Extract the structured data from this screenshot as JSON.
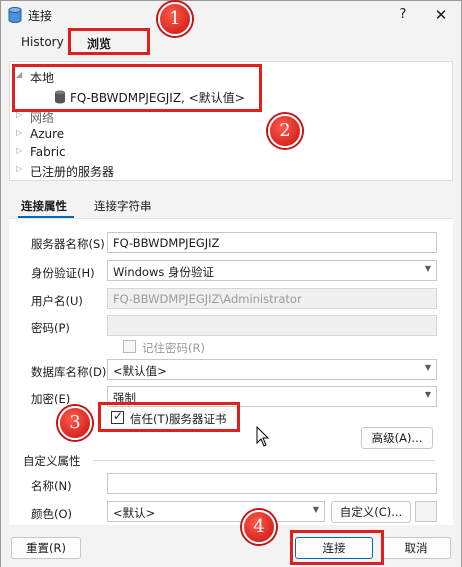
{
  "titlebar": {
    "title": "连接",
    "help": "?",
    "close": "✕"
  },
  "top_tabs": {
    "history": "History",
    "browse": "浏览"
  },
  "tree": {
    "local": "本地",
    "server": "FQ-BBWDMPJEGJIZ, <默认值>",
    "network": "网络",
    "azure": "Azure",
    "fabric": "Fabric",
    "registered": "已注册的服务器"
  },
  "sub_tabs": {
    "props": "连接属性",
    "conn_string": "连接字符串"
  },
  "form": {
    "server_label": "服务器名称(S)",
    "server_value": "FQ-BBWDMPJEGJIZ",
    "auth_label": "身份验证(H)",
    "auth_value": "Windows 身份验证",
    "user_label": "用户名(U)",
    "user_value": "FQ-BBWDMPJEGJIZ\\Administrator",
    "password_label": "密码(P)",
    "password_value": "",
    "remember_label": "记住密码(R)",
    "remember_checked": false,
    "db_label": "数据库名称(D)",
    "db_value": "<默认值>",
    "encrypt_label": "加密(E)",
    "encrypt_value": "强制",
    "trust_label": "信任(T)服务器证书",
    "trust_checked": true,
    "advanced_btn": "高级(A)...",
    "custom_group": "自定义属性",
    "name_label": "名称(N)",
    "name_value": "",
    "color_label": "颜色(O)",
    "color_value": "<默认>",
    "custom_btn": "自定义(C)..."
  },
  "footer": {
    "reset": "重置(R)",
    "connect": "连接",
    "cancel": "取消"
  },
  "annotations": {
    "n1": "1",
    "n2": "2",
    "n3": "3",
    "n4": "4"
  },
  "colors": {
    "accent": "#0067c0",
    "annotation": "#e02020"
  }
}
